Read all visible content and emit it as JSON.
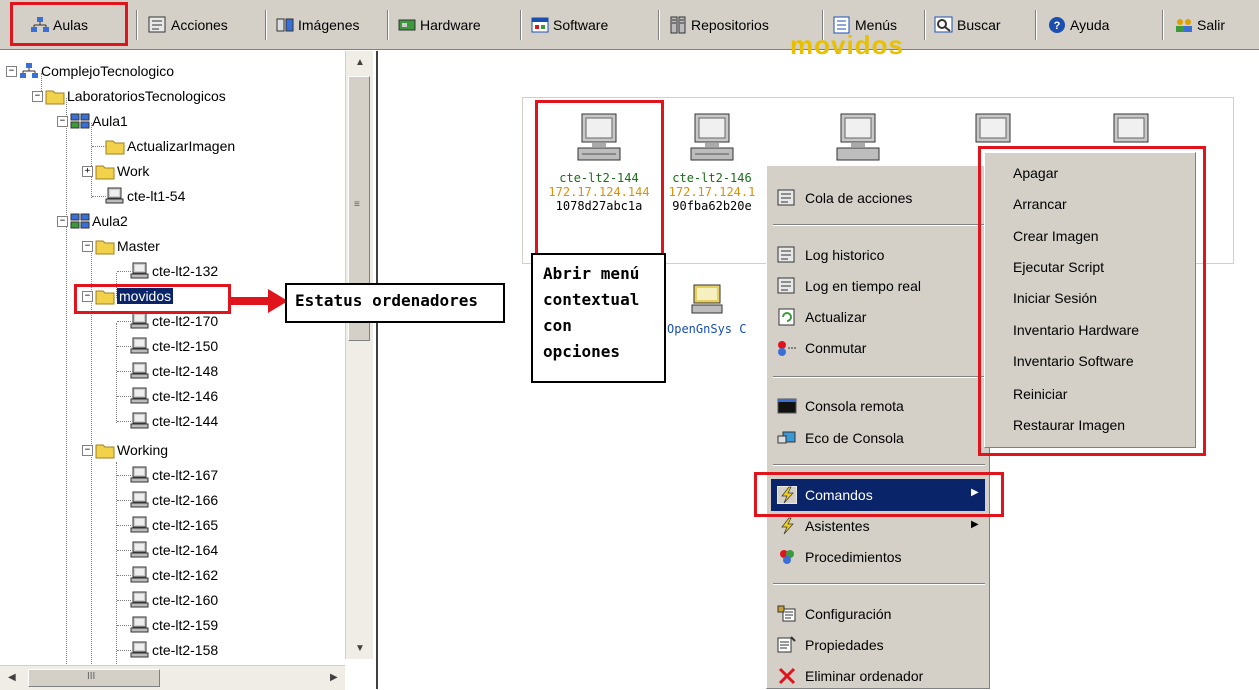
{
  "toolbar": {
    "items": [
      {
        "label": "Aulas",
        "icon": "network-icon"
      },
      {
        "label": "Acciones",
        "icon": "actions-icon"
      },
      {
        "label": "Imágenes",
        "icon": "images-icon"
      },
      {
        "label": "Hardware",
        "icon": "hardware-icon"
      },
      {
        "label": "Software",
        "icon": "software-icon"
      },
      {
        "label": "Repositorios",
        "icon": "repository-icon"
      },
      {
        "label": "Menús",
        "icon": "menu-icon"
      },
      {
        "label": "Buscar",
        "icon": "search-icon"
      },
      {
        "label": "Ayuda",
        "icon": "help-icon"
      },
      {
        "label": "Salir",
        "icon": "users-exit-icon"
      }
    ]
  },
  "tree": {
    "items": [
      {
        "label": "ComplejoTecnologico",
        "icon": "network-icon"
      },
      {
        "label": "LaboratoriosTecnologicos",
        "icon": "folder-icon"
      },
      {
        "label": "Aula1",
        "icon": "classroom-icon"
      },
      {
        "label": "ActualizarImagen",
        "icon": "folder-icon"
      },
      {
        "label": "Work",
        "icon": "folder-icon"
      },
      {
        "label": "cte-lt1-54",
        "icon": "computer-icon"
      },
      {
        "label": "Aula2",
        "icon": "classroom-icon"
      },
      {
        "label": "Master",
        "icon": "folder-icon"
      },
      {
        "label": "cte-lt2-132",
        "icon": "computer-icon"
      },
      {
        "label": "movidos",
        "icon": "folder-icon"
      },
      {
        "label": "cte-lt2-170",
        "icon": "computer-icon"
      },
      {
        "label": "cte-lt2-150",
        "icon": "computer-icon"
      },
      {
        "label": "cte-lt2-148",
        "icon": "computer-icon"
      },
      {
        "label": "cte-lt2-146",
        "icon": "computer-icon"
      },
      {
        "label": "cte-lt2-144",
        "icon": "computer-icon"
      },
      {
        "label": "Working",
        "icon": "folder-icon"
      },
      {
        "label": "cte-lt2-167",
        "icon": "computer-icon"
      },
      {
        "label": "cte-lt2-166",
        "icon": "computer-icon"
      },
      {
        "label": "cte-lt2-165",
        "icon": "computer-icon"
      },
      {
        "label": "cte-lt2-164",
        "icon": "computer-icon"
      },
      {
        "label": "cte-lt2-162",
        "icon": "computer-icon"
      },
      {
        "label": "cte-lt2-160",
        "icon": "computer-icon"
      },
      {
        "label": "cte-lt2-159",
        "icon": "computer-icon"
      },
      {
        "label": "cte-lt2-158",
        "icon": "computer-icon"
      }
    ]
  },
  "callouts": {
    "status": "Estatus ordenadores",
    "menu": [
      "Abrir menú",
      "contextual",
      "con",
      "opciones"
    ]
  },
  "main": {
    "title": "movidos",
    "computers": [
      {
        "name": "cte-lt2-144",
        "ip": "172.17.124.144",
        "mac": "1078d27abc1a"
      },
      {
        "name": "cte-lt2-146",
        "ip": "172.17.124.1",
        "mac": "90fba62b20e"
      }
    ],
    "repo_label": "OpenGnSys C"
  },
  "context_menu": {
    "items": [
      {
        "label": "Cola de acciones",
        "icon": "actions-icon"
      },
      {
        "label": "Log historico",
        "icon": "log-icon"
      },
      {
        "label": "Log en tiempo real",
        "icon": "log-realtime-icon"
      },
      {
        "label": "Actualizar",
        "icon": "refresh-icon"
      },
      {
        "label": "Conmutar",
        "icon": "switch-icon"
      },
      {
        "label": "Consola remota",
        "icon": "console-icon"
      },
      {
        "label": "Eco de Consola",
        "icon": "console-echo-icon"
      },
      {
        "label": "Comandos",
        "icon": "lightning-icon",
        "selected": true
      },
      {
        "label": "Asistentes",
        "icon": "lightning-icon"
      },
      {
        "label": "Procedimientos",
        "icon": "procedures-icon"
      },
      {
        "label": "Configuración",
        "icon": "configuration-icon"
      },
      {
        "label": "Propiedades",
        "icon": "properties-icon"
      },
      {
        "label": "Eliminar ordenador",
        "icon": "delete-icon"
      }
    ]
  },
  "submenu": {
    "items": [
      "Apagar",
      "Arrancar",
      "Crear Imagen",
      "Ejecutar Script",
      "Iniciar Sesión",
      "Inventario Hardware",
      "Inventario Software",
      "Reiniciar",
      "Restaurar Imagen"
    ]
  },
  "colors": {
    "highlight_red": "#e0141c",
    "selection": "#0a246a",
    "title_yellow": "#e8c000",
    "ip_orange": "#e09000",
    "name_green": "#1a6d1a"
  }
}
